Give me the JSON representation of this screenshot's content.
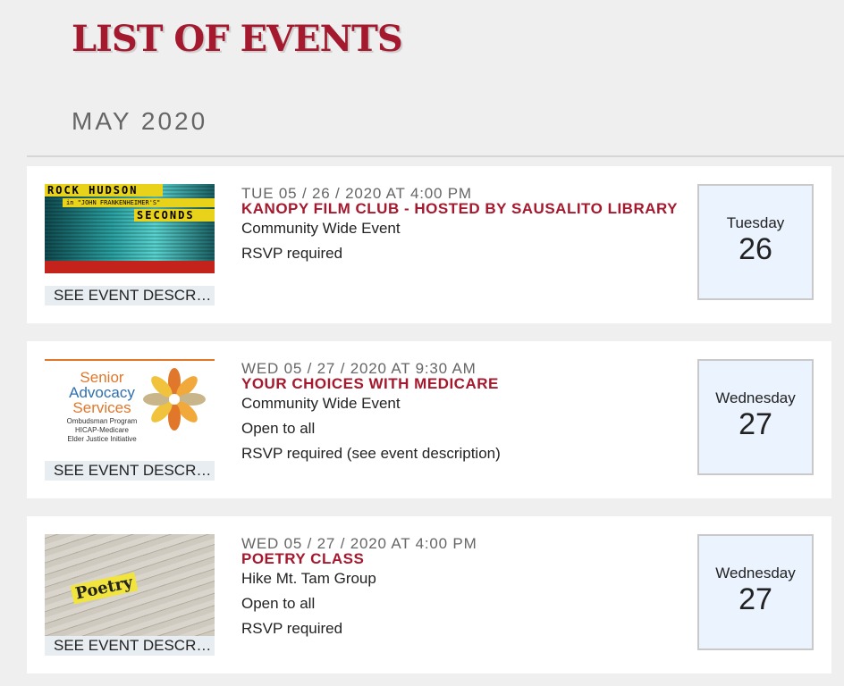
{
  "page": {
    "title": "LIST OF EVENTS",
    "month": "MAY 2020"
  },
  "events": [
    {
      "datetime": "TUE 05 / 26 / 2020 AT 4:00 PM",
      "title": "KANOPY FILM CLUB - HOSTED BY SAUSALITO LIBRARY",
      "details": [
        "Community Wide Event",
        "RSVP required"
      ],
      "see_description": "SEE EVENT DESCRIPTION",
      "cal_weekday": "Tuesday",
      "cal_day": "26",
      "image": {
        "line1": "ROCK HUDSON",
        "line2": "in \"JOHN FRANKENHEIMER'S\"",
        "line3": "SECONDS"
      }
    },
    {
      "datetime": "WED 05 / 27 / 2020 AT 9:30 AM",
      "title": "YOUR CHOICES WITH MEDICARE",
      "details": [
        "Community Wide Event",
        "Open to all",
        "RSVP required (see event description)"
      ],
      "see_description": "SEE EVENT DESCRIPTION",
      "cal_weekday": "Wednesday",
      "cal_day": "27",
      "image": {
        "line1": "Senior",
        "line2": "Advocacy",
        "line3": "Services",
        "line4": "Ombudsman Program",
        "line5": "HICAP-Medicare",
        "line6": "Elder Justice Initiative"
      }
    },
    {
      "datetime": "WED 05 / 27 / 2020 AT 4:00 PM",
      "title": "POETRY CLASS",
      "details": [
        "Hike Mt. Tam Group",
        "Open to all",
        "RSVP required"
      ],
      "see_description": "SEE EVENT DESCRIPTION",
      "cal_weekday": "Wednesday",
      "cal_day": "27",
      "image": {
        "line1": "Poetry"
      }
    }
  ],
  "colors": {
    "accent": "#a5192e",
    "calendar_bg": "#eaf3fe",
    "page_bg": "#efefef"
  }
}
